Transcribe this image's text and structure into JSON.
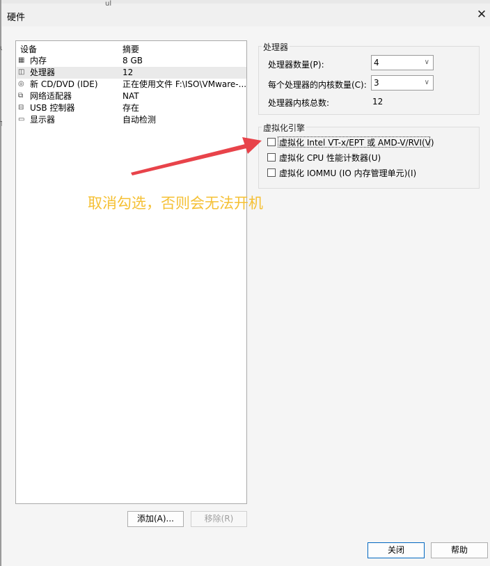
{
  "dialog": {
    "title": "硬件",
    "close_glyph": "✕"
  },
  "background_text": [
    "ul",
    "un",
    "T"
  ],
  "device_list": {
    "header_device": "设备",
    "header_summary": "摘要",
    "rows": [
      {
        "icon": "memory-icon",
        "glyph": "▦",
        "name": "内存",
        "summary": "8 GB",
        "selected": false
      },
      {
        "icon": "processor-icon",
        "glyph": "◫",
        "name": "处理器",
        "summary": "12",
        "selected": true
      },
      {
        "icon": "cd-dvd-icon",
        "glyph": "◎",
        "name": "新 CD/DVD (IDE)",
        "summary": "正在使用文件 F:\\ISO\\VMware-...",
        "selected": false
      },
      {
        "icon": "network-adapter-icon",
        "glyph": "⧉",
        "name": "网络适配器",
        "summary": "NAT",
        "selected": false
      },
      {
        "icon": "usb-controller-icon",
        "glyph": "⊟",
        "name": "USB 控制器",
        "summary": "存在",
        "selected": false
      },
      {
        "icon": "display-icon",
        "glyph": "▭",
        "name": "显示器",
        "summary": "自动检测",
        "selected": false
      }
    ]
  },
  "buttons": {
    "add": "添加(A)...",
    "remove": "移除(R)",
    "close": "关闭",
    "help": "帮助"
  },
  "processors": {
    "group_label": "处理器",
    "count_label": "处理器数量(P):",
    "count_value": "4",
    "cores_label": "每个处理器的内核数量(C):",
    "cores_value": "3",
    "total_label": "处理器内核总数:",
    "total_value": "12"
  },
  "virtualization": {
    "group_label": "虚拟化引擎",
    "options": [
      {
        "label": "虚拟化 Intel VT-x/EPT 或 AMD-V/RVI(V)",
        "checked": false
      },
      {
        "label": "虚拟化 CPU 性能计数器(U)",
        "checked": false
      },
      {
        "label": "虚拟化 IOMMU (IO 内存管理单元)(I)",
        "checked": false
      }
    ]
  },
  "annotation": {
    "text": "取消勾选，否则会无法开机",
    "color": "#f5c034",
    "arrow_color": "#e8434a"
  },
  "colors": {
    "accent": "#0067c0",
    "selection": "#eaeaea"
  }
}
